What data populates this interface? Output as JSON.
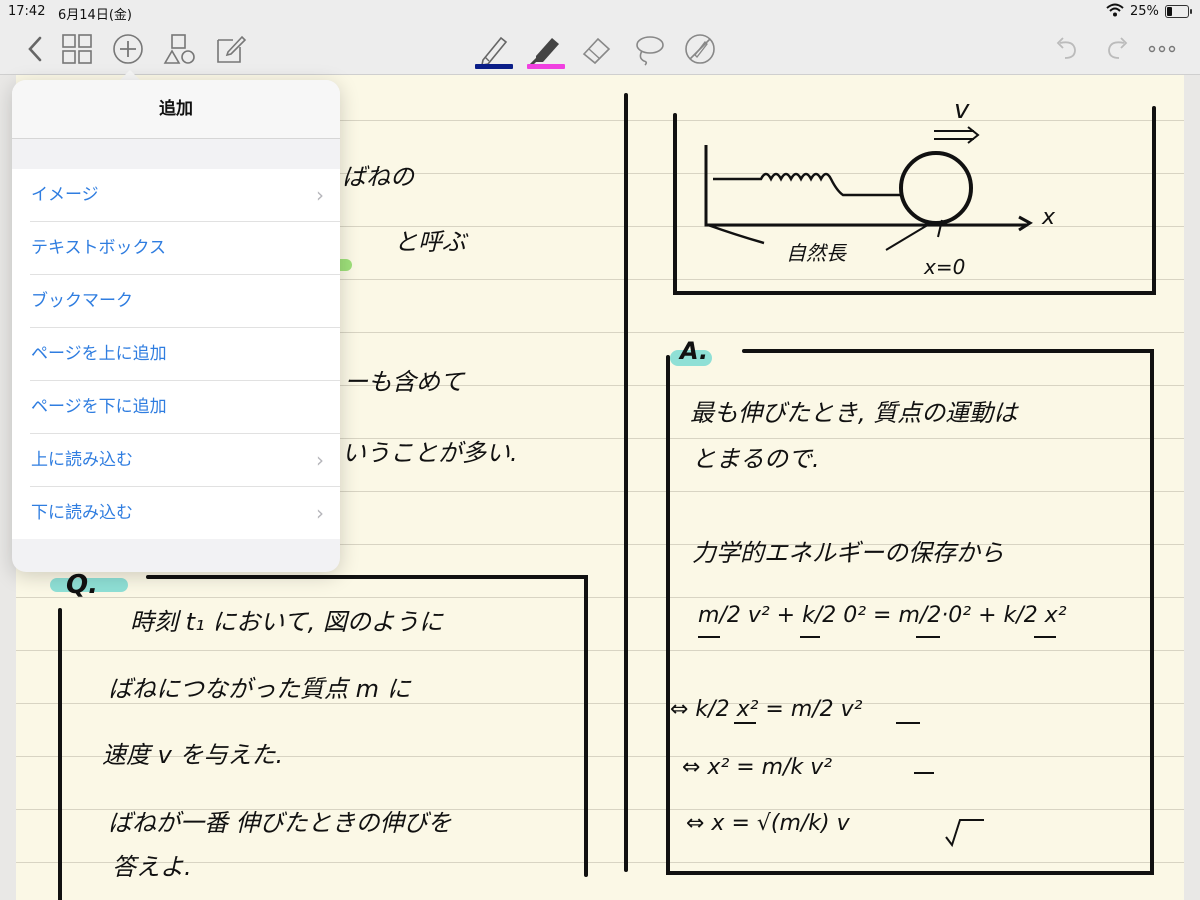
{
  "status": {
    "time": "17:42",
    "date": "6月14日(金)",
    "battery": "25%",
    "battery_level": 0.25
  },
  "toolbar": {
    "icons": [
      "back-icon",
      "grid-icon",
      "add-icon",
      "shapes-icon",
      "edit-icon",
      "pencil-icon",
      "highlighter-icon",
      "eraser-icon",
      "lasso-icon",
      "no-touch-icon",
      "undo-icon",
      "redo-icon",
      "more-icon"
    ],
    "pen_color": "#0a1e88",
    "highlighter_color": "#f040e0"
  },
  "popover": {
    "title": "追加",
    "items": [
      {
        "label": "イメージ",
        "chevron": "›"
      },
      {
        "label": "テキストボックス",
        "chevron": ""
      },
      {
        "label": "ブックマーク",
        "chevron": ""
      },
      {
        "label": "ページを上に追加",
        "chevron": ""
      },
      {
        "label": "ページを下に追加",
        "chevron": ""
      },
      {
        "label": "上に読み込む",
        "chevron": "›"
      },
      {
        "label": "下に読み込む",
        "chevron": "›"
      }
    ]
  },
  "notes": {
    "left_partial": [
      "ばねの",
      "と呼ぶ",
      "ーも含めて",
      "いうことが多い."
    ],
    "question_label": "Q.",
    "question_lines": [
      "時刻 t₁ において, 図のように",
      "ばねにつながった質点 m に",
      "速度 v を与えた.",
      "ばねが一番 伸びたときの伸びを",
      "答えよ."
    ],
    "figure": {
      "v_label": "v",
      "spring_label": "自然長",
      "origin_label": "x=0",
      "axis_label": "x"
    },
    "answer_label": "A.",
    "answer_lines": [
      "最も伸びたとき, 質点の運動は",
      "とまるので.",
      "力学的エネルギーの保存から"
    ],
    "equations": [
      "m/2 v² + k/2 0² = m/2·0² + k/2 x²",
      "⇔  k/2 x² = m/2 v²",
      "⇔  x² = m/k v²",
      "⇔  x = √(m/k) v"
    ]
  }
}
